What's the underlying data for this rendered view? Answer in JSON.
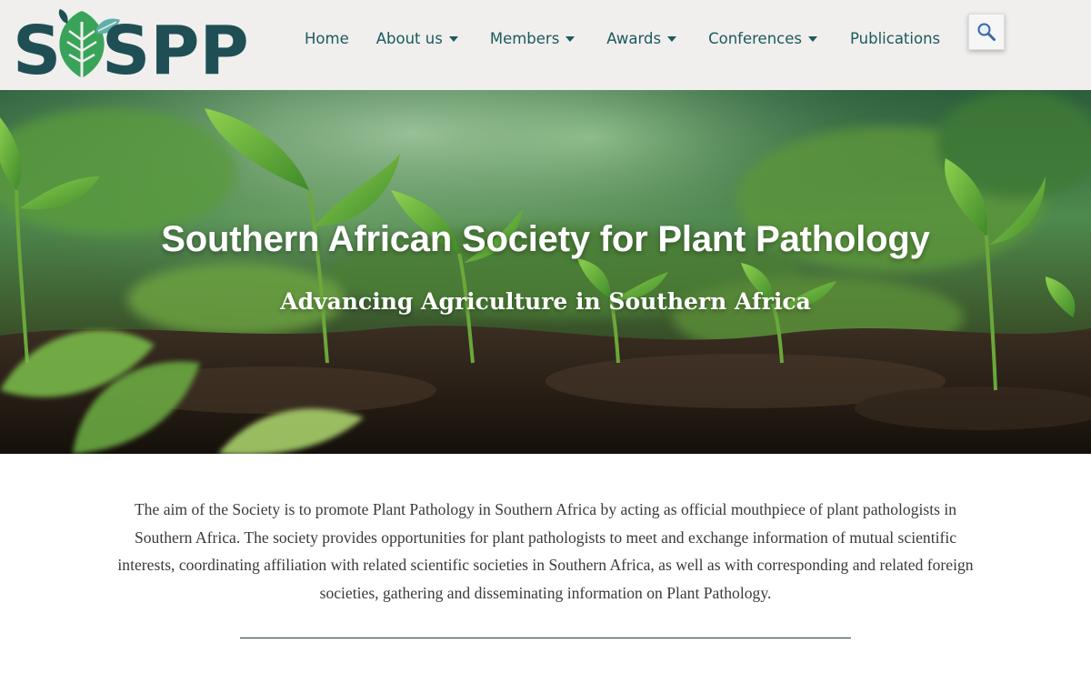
{
  "header": {
    "logo_text": "SASPP",
    "nav": [
      {
        "label": "Home",
        "dropdown": false
      },
      {
        "label": "About us",
        "dropdown": true
      },
      {
        "label": "Members",
        "dropdown": true
      },
      {
        "label": "Awards",
        "dropdown": true
      },
      {
        "label": "Conferences",
        "dropdown": true
      },
      {
        "label": "Publications",
        "dropdown": false
      }
    ],
    "search_icon": "search-icon"
  },
  "hero": {
    "title": "Southern African Society for Plant Pathology",
    "subtitle": "Advancing Agriculture in Southern Africa"
  },
  "main": {
    "intro": "The aim of the Society is to promote Plant Pathology in Southern Africa by acting as official mouthpiece of plant pathologists in Southern Africa. The society provides opportunities for plant pathologists to meet and exchange information of mutual scientific interests, coordinating affiliation with related scientific societies in Southern Africa, as well as with corresponding and related foreign societies, gathering and disseminating information on Plant Pathology."
  },
  "colors": {
    "brand_dark": "#1f4f55",
    "leaf_green": "#3aa35a",
    "nav_text": "#1b5a5f",
    "header_bg": "#f0efed"
  }
}
